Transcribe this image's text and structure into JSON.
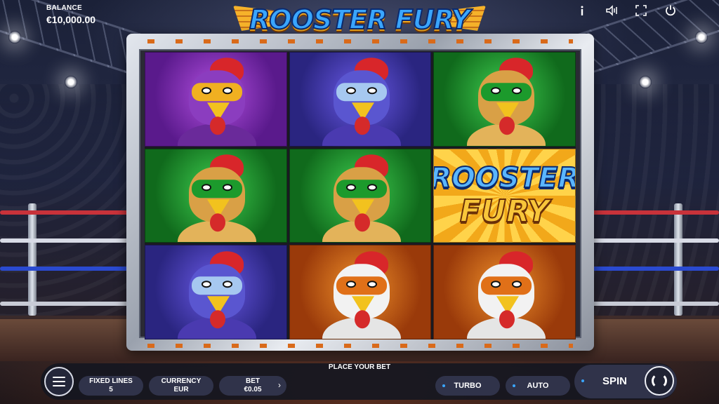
{
  "header": {
    "balance_label": "BALANCE",
    "balance_value": "€10,000.00",
    "game_title": "ROOSTER FURY"
  },
  "top_icons": [
    "info-icon",
    "sound-icon",
    "fullscreen-icon",
    "power-icon"
  ],
  "reels": {
    "rows": [
      [
        "purple-rooster",
        "blue-rooster",
        "green-rooster"
      ],
      [
        "green-rooster",
        "green-rooster",
        "rooster-fury-wild"
      ],
      [
        "blue-rooster",
        "orange-rooster",
        "orange-rooster"
      ]
    ],
    "wild_line1": "ROOSTER",
    "wild_line2": "FURY"
  },
  "controls": {
    "place_bet": "PLACE YOUR BET",
    "fixed_lines_label": "FIXED LINES",
    "fixed_lines_value": "5",
    "currency_label": "CURRENCY",
    "currency_value": "EUR",
    "bet_label": "BET",
    "bet_value": "€0.05",
    "turbo_label": "TURBO",
    "auto_label": "AUTO",
    "spin_label": "SPIN"
  },
  "colors": {
    "accent_blue": "#3aa6ff",
    "title_gold": "#f2a91d",
    "pill_bg": "#30334a"
  }
}
